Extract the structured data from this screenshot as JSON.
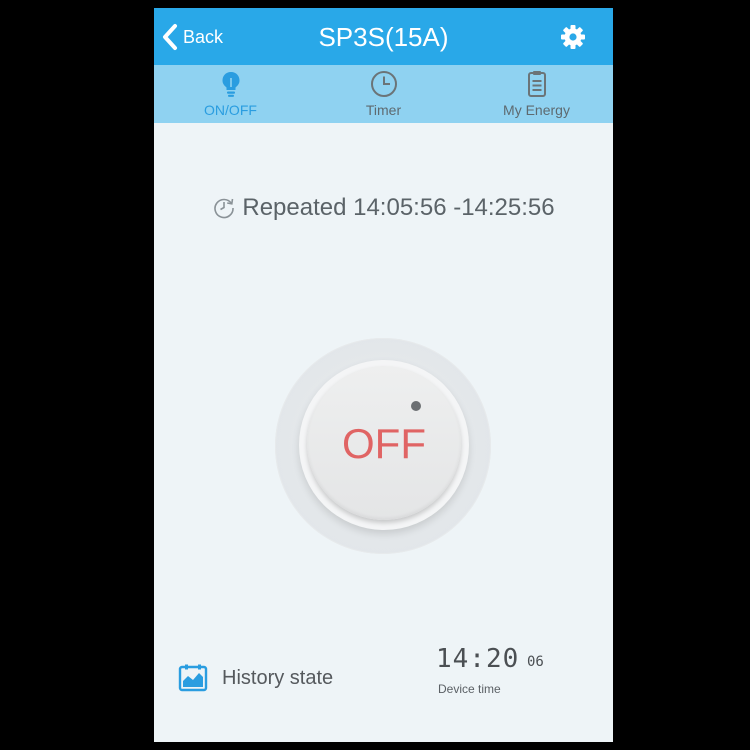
{
  "header": {
    "back_label": "Back",
    "title": "SP3S(15A)",
    "settings_icon": "gear-icon"
  },
  "tabs": [
    {
      "label": "ON/OFF",
      "icon": "lightbulb-icon",
      "active": true
    },
    {
      "label": "Timer",
      "icon": "clock-icon",
      "active": false
    },
    {
      "label": "My Energy",
      "icon": "clipboard-icon",
      "active": false
    }
  ],
  "schedule": {
    "text": "Repeated 14:05:56 -14:25:56",
    "icon": "repeat-clock-icon"
  },
  "power": {
    "state_label": "OFF"
  },
  "history": {
    "label": "History state",
    "icon": "chart-calendar-icon"
  },
  "device_time": {
    "hours_minutes": "14:20",
    "seconds": "06",
    "label": "Device time"
  },
  "colors": {
    "header": "#29a8e8",
    "tab_bar": "#8fd2f1",
    "active_tab": "#2a9de0",
    "off_text": "#e06464",
    "background": "#eef4f7"
  }
}
